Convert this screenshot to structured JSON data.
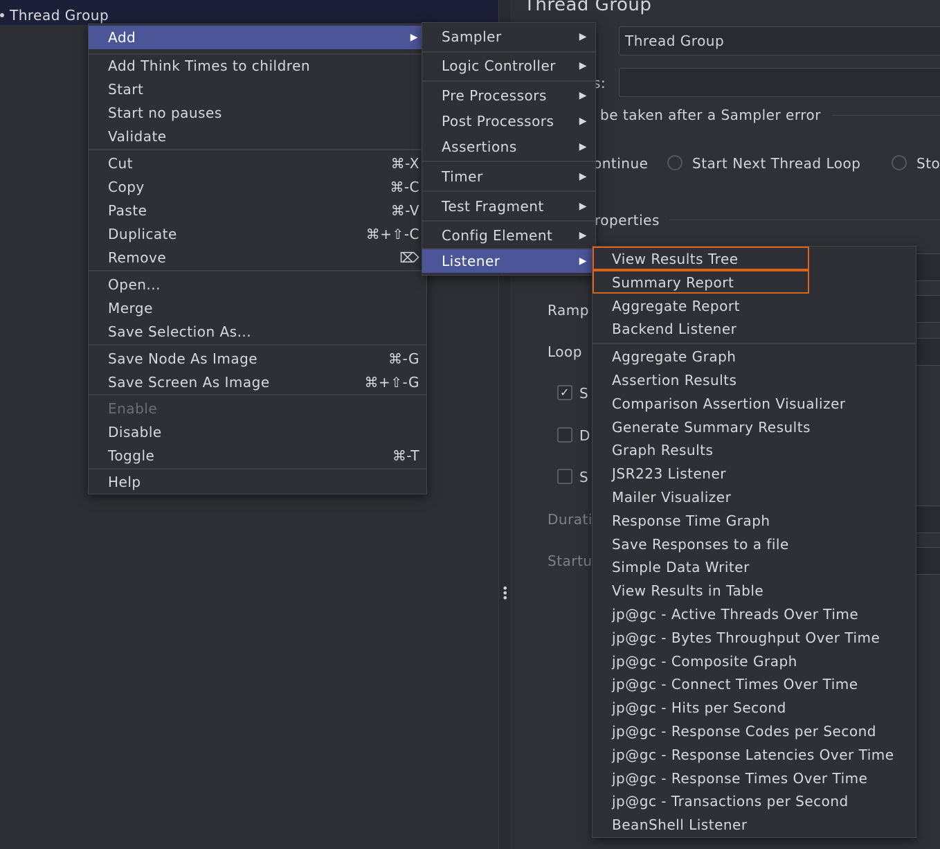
{
  "tree": {
    "node_label": "Thread Group"
  },
  "right_panel": {
    "title": "Thread Group",
    "name_value": "Thread Group",
    "comments_label_fragment": "s:",
    "error_action_legend": "be taken after a Sampler error",
    "radio_continue": "ontinue",
    "radio_next_loop": "Start Next Thread Loop",
    "radio_stop": "Sto",
    "properties_legend": "roperties",
    "ramp_label": "Ramp",
    "loop_label": "Loop",
    "check1_label": "S",
    "check2_label": "D",
    "check3_label": "S",
    "duration_label": "Durati",
    "startup_label": "Startu"
  },
  "context_menu": {
    "add": "Add",
    "add_think_times": "Add Think Times to children",
    "start": "Start",
    "start_no_pauses": "Start no pauses",
    "validate": "Validate",
    "cut": "Cut",
    "cut_sc": "⌘-X",
    "copy": "Copy",
    "copy_sc": "⌘-C",
    "paste": "Paste",
    "paste_sc": "⌘-V",
    "duplicate": "Duplicate",
    "duplicate_sc": "⌘+⇧-C",
    "remove": "Remove",
    "remove_sc": "⌦",
    "open": "Open...",
    "merge": "Merge",
    "save_selection": "Save Selection As...",
    "save_node_image": "Save Node As Image",
    "save_node_image_sc": "⌘-G",
    "save_screen_image": "Save Screen As Image",
    "save_screen_image_sc": "⌘+⇧-G",
    "enable": "Enable",
    "disable": "Disable",
    "toggle": "Toggle",
    "toggle_sc": "⌘-T",
    "help": "Help"
  },
  "add_submenu": {
    "sampler": "Sampler",
    "logic_controller": "Logic Controller",
    "pre_processors": "Pre Processors",
    "post_processors": "Post Processors",
    "assertions": "Assertions",
    "timer": "Timer",
    "test_fragment": "Test Fragment",
    "config_element": "Config Element",
    "listener": "Listener"
  },
  "listener_submenu": {
    "items": [
      "View Results Tree",
      "Summary Report",
      "Aggregate Report",
      "Backend Listener",
      "Aggregate Graph",
      "Assertion Results",
      "Comparison Assertion Visualizer",
      "Generate Summary Results",
      "Graph Results",
      "JSR223 Listener",
      "Mailer Visualizer",
      "Response Time Graph",
      "Save Responses to a file",
      "Simple Data Writer",
      "View Results in Table",
      "jp@gc - Active Threads Over Time",
      "jp@gc - Bytes Throughput Over Time",
      "jp@gc - Composite Graph",
      "jp@gc - Connect Times Over Time",
      "jp@gc - Hits per Second",
      "jp@gc - Response Codes per Second",
      "jp@gc - Response Latencies Over Time",
      "jp@gc - Response Times Over Time",
      "jp@gc - Transactions per Second",
      "BeanShell Listener"
    ]
  },
  "colors": {
    "menu_active": "#4c5598",
    "highlight_box": "#d9641d",
    "background": "#2f3036"
  }
}
